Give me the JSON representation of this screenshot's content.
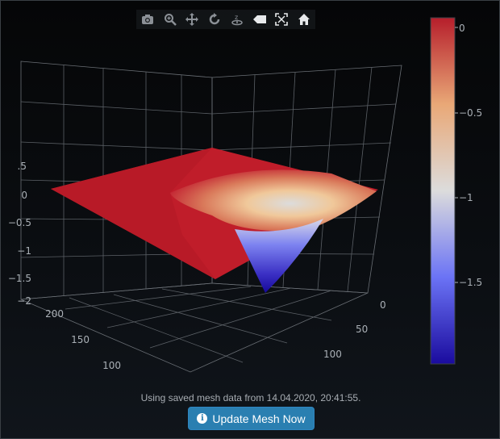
{
  "modebar": {
    "icons": [
      "camera-icon",
      "zoom-icon",
      "pan-icon",
      "orbit-icon",
      "turntable-icon",
      "reset-camera-icon",
      "autoscale-icon",
      "home-icon"
    ]
  },
  "chart_data": {
    "type": "surface",
    "z_axis_ticks": [
      "−2",
      "−1.5",
      "−1",
      "−0.5",
      "0",
      ".5"
    ],
    "x_axis_ticks": [
      "0",
      "50",
      "100"
    ],
    "y_axis_ticks": [
      "200",
      "150",
      "100"
    ],
    "colorbar": {
      "ticks": [
        "0",
        "−0.5",
        "−1",
        "−1.5"
      ],
      "range": [
        -1.95,
        0.05
      ],
      "colors": [
        "#1a0b9e",
        "#6b73f5",
        "#dcdcdc",
        "#e9a877",
        "#b61e2b"
      ]
    },
    "grid": true
  },
  "caption": "Using saved mesh data from 14.04.2020, 20:41:55.",
  "button": {
    "label": "Update Mesh Now",
    "color": "#2a7fb1"
  }
}
